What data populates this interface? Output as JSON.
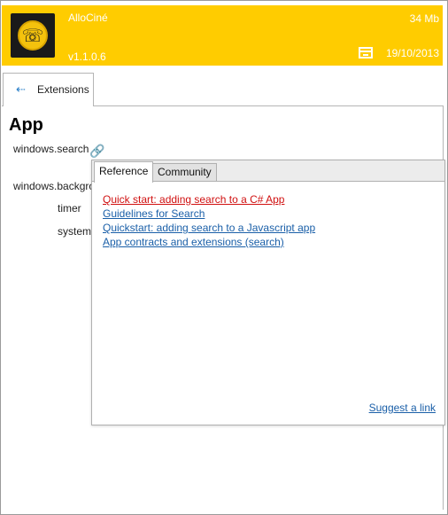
{
  "header": {
    "app_name": "AlloCiné",
    "version": "v1.1.0.6",
    "size": "34 Mb",
    "date": "19/10/2013",
    "icon_glyph": "☏",
    "color": "#ffcc00"
  },
  "tabs": {
    "extensions_label": "Extensions",
    "extensions_icon": "usb-icon"
  },
  "section": {
    "title": "App"
  },
  "items": {
    "search": "windows.search",
    "background": "windows.backgro",
    "timer": "timer",
    "system": "system"
  },
  "popup": {
    "tabs": [
      "Reference",
      "Community"
    ],
    "links": [
      "Quick start: adding search to a C# App",
      "Guidelines for Search",
      "Quickstart: adding search to a Javascript app",
      "App contracts and extensions (search)"
    ],
    "suggest": "Suggest a link",
    "visited_color": "#d01010",
    "link_color": "#1a5fa8"
  }
}
